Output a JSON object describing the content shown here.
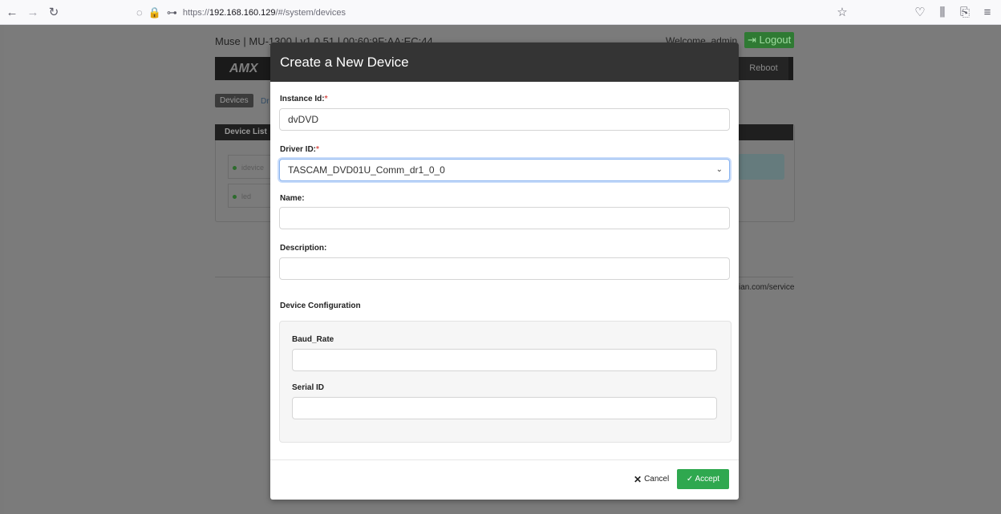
{
  "browser": {
    "url_prefix": "https://",
    "url_host": "192.168.160.129",
    "url_path": "/#/system/devices"
  },
  "background": {
    "title": "Muse | MU-1300 | v1.0.51 | 00:60:9F:AA:EC:44",
    "welcome": "Welcome, admin",
    "logout_label": "Logout",
    "logo": "AMX",
    "reboot_label": "Reboot",
    "tab_devices": "Devices",
    "tab_drivers": "Dr",
    "panel_title": "Device List",
    "items": [
      "idevice",
      "led"
    ],
    "footer_link": "ian.com/service"
  },
  "modal": {
    "title": "Create a New Device",
    "instance_label": "Instance Id:",
    "instance_value": "dvDVD",
    "driver_label": "Driver ID:",
    "driver_value": "TASCAM_DVD01U_Comm_dr1_0_0",
    "name_label": "Name:",
    "name_value": "",
    "description_label": "Description:",
    "description_value": "",
    "config_label": "Device Configuration",
    "baud_label": "Baud_Rate",
    "baud_value": "",
    "serial_label": "Serial ID",
    "serial_value": "",
    "cancel_label": "Cancel",
    "accept_label": "Accept",
    "required_mark": "*"
  }
}
